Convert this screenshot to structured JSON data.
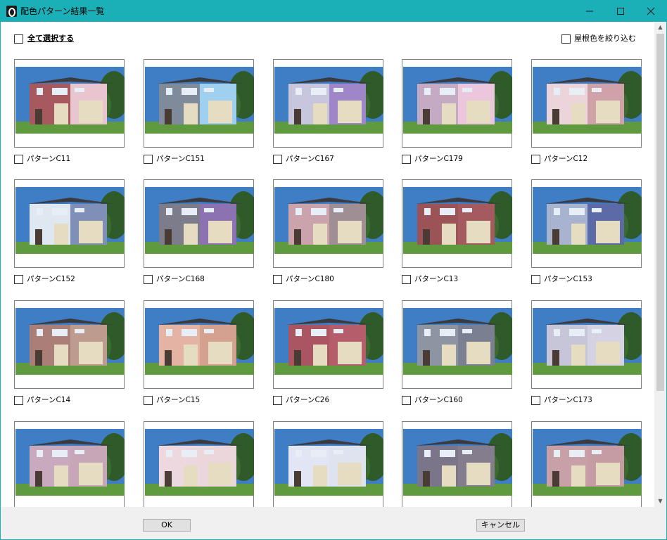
{
  "window": {
    "title": "配色パターン結果一覧",
    "minimize_icon": "minimize-icon",
    "maximize_icon": "maximize-icon",
    "close_icon": "close-icon"
  },
  "header": {
    "select_all_label": "全て選択する",
    "roof_filter_label": "屋根色を絞り込む"
  },
  "patterns": [
    {
      "label": "パターンC11",
      "wall_left": "#a8585f",
      "wall_right": "#e9c6cf",
      "checked": false
    },
    {
      "label": "パターンC151",
      "wall_left": "#7f8b9b",
      "wall_right": "#9fd0ef",
      "checked": false
    },
    {
      "label": "パターンC167",
      "wall_left": "#c8c6dd",
      "wall_right": "#9f86c8",
      "checked": false
    },
    {
      "label": "パターンC179",
      "wall_left": "#c5aac4",
      "wall_right": "#ecc6dc",
      "checked": false
    },
    {
      "label": "パターンC12",
      "wall_left": "#ebd5db",
      "wall_right": "#cfa1a8",
      "checked": false
    },
    {
      "label": "パターンC152",
      "wall_left": "#dfe7f1",
      "wall_right": "#7f8fb8",
      "checked": false
    },
    {
      "label": "パターンC168",
      "wall_left": "#7c7c8a",
      "wall_right": "#8c72b0",
      "checked": false
    },
    {
      "label": "パターンC180",
      "wall_left": "#caa3ad",
      "wall_right": "#9f8f95",
      "checked": false
    },
    {
      "label": "パターンC13",
      "wall_left": "#9b5358",
      "wall_right": "#a55a60",
      "checked": false
    },
    {
      "label": "パターンC153",
      "wall_left": "#a7b3cf",
      "wall_right": "#5d6aa8",
      "checked": false
    },
    {
      "label": "パターンC14",
      "wall_left": "#a97f78",
      "wall_right": "#bd9b8e",
      "checked": false
    },
    {
      "label": "パターンC15",
      "wall_left": "#e4b3a3",
      "wall_right": "#d4a090",
      "checked": false
    },
    {
      "label": "パターンC26",
      "wall_left": "#ab5563",
      "wall_right": "#b65d6b",
      "checked": false
    },
    {
      "label": "パターンC160",
      "wall_left": "#8d95a3",
      "wall_right": "#7a8092",
      "checked": false
    },
    {
      "label": "パターンC173",
      "wall_left": "#c6c6d8",
      "wall_right": "#d4d2e3",
      "checked": false
    },
    {
      "label": "",
      "wall_left": "#c9a9bd",
      "wall_right": "#c7a6b7",
      "checked": false
    },
    {
      "label": "",
      "wall_left": "#eed8e0",
      "wall_right": "#ebd6db",
      "checked": false
    },
    {
      "label": "",
      "wall_left": "#e2e6f4",
      "wall_right": "#dfe2ef",
      "checked": false
    },
    {
      "label": "",
      "wall_left": "#7a7588",
      "wall_right": "#837d8d",
      "checked": false
    },
    {
      "label": "",
      "wall_left": "#c8a0a7",
      "wall_right": "#c59ca3",
      "checked": false
    }
  ],
  "footer": {
    "ok_label": "OK",
    "cancel_label": "キャンセル"
  },
  "colors": {
    "titlebar": "#1bb0b8",
    "sky": "#3f7dc4",
    "grass": "#5f9a3e",
    "shutter": "#e6dcc2",
    "roof": "#3b3b3f"
  }
}
